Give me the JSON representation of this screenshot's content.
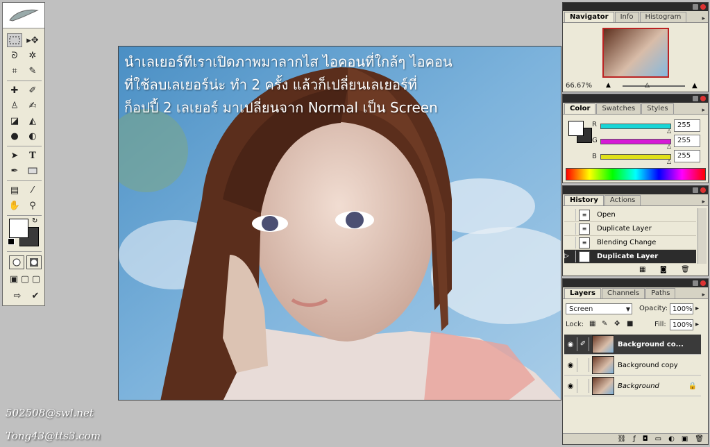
{
  "toolbox": {
    "tools": [
      "marquee-tool",
      "move-tool",
      "lasso-tool",
      "magic-wand-tool",
      "crop-tool",
      "slice-tool",
      "healing-brush-tool",
      "brush-tool",
      "clone-stamp-tool",
      "history-brush-tool",
      "eraser-tool",
      "paint-bucket-tool",
      "blur-tool",
      "dodge-tool",
      "path-selection-tool",
      "type-tool",
      "pen-tool",
      "rectangle-tool",
      "notes-tool",
      "eyedropper-tool",
      "hand-tool",
      "zoom-tool"
    ],
    "type_glyph": "T"
  },
  "canvas": {
    "caption_lines": [
      "นำเลเยอร์ทีเราเปิดภาพมาลากไส ไอคอนที่ใกล้ๆ  ไอคอน",
      "ที่ใช้ลบเลเยอร์น่ะ ทำ 2 ครั้ง แล้วก็เปลี่ยนเลเยอร์ที่",
      "ก็อปปี้ 2 เลเยอร์ มาเปลี่ยนจาก Normal เป็น Screen"
    ]
  },
  "navigator": {
    "tabs": [
      "Navigator",
      "Info",
      "Histogram"
    ],
    "zoom": "66.67%"
  },
  "color": {
    "tabs": [
      "Color",
      "Swatches",
      "Styles"
    ],
    "channels": [
      {
        "label": "R",
        "value": "255",
        "color": "#19d6d6"
      },
      {
        "label": "G",
        "value": "255",
        "color": "#d61ad6"
      },
      {
        "label": "B",
        "value": "255",
        "color": "#e0e01a"
      }
    ]
  },
  "history": {
    "tabs": [
      "History",
      "Actions"
    ],
    "items": [
      "Open",
      "Duplicate Layer",
      "Blending Change",
      "Duplicate Layer"
    ]
  },
  "layers": {
    "tabs": [
      "Layers",
      "Channels",
      "Paths"
    ],
    "blend_mode": "Screen",
    "opacity_label": "Opacity:",
    "opacity": "100%",
    "lock_label": "Lock:",
    "fill_label": "Fill:",
    "fill": "100%",
    "rows": [
      "Background co...",
      "Background copy",
      "Background"
    ]
  },
  "watermarks": {
    "line1": "502508@swl.net",
    "line2": "Tong43@tts3.com"
  },
  "colors": {
    "panel_bg": "#ece9d8",
    "workspace": "#c0c0c0",
    "highlight": "#2c2c2c"
  }
}
